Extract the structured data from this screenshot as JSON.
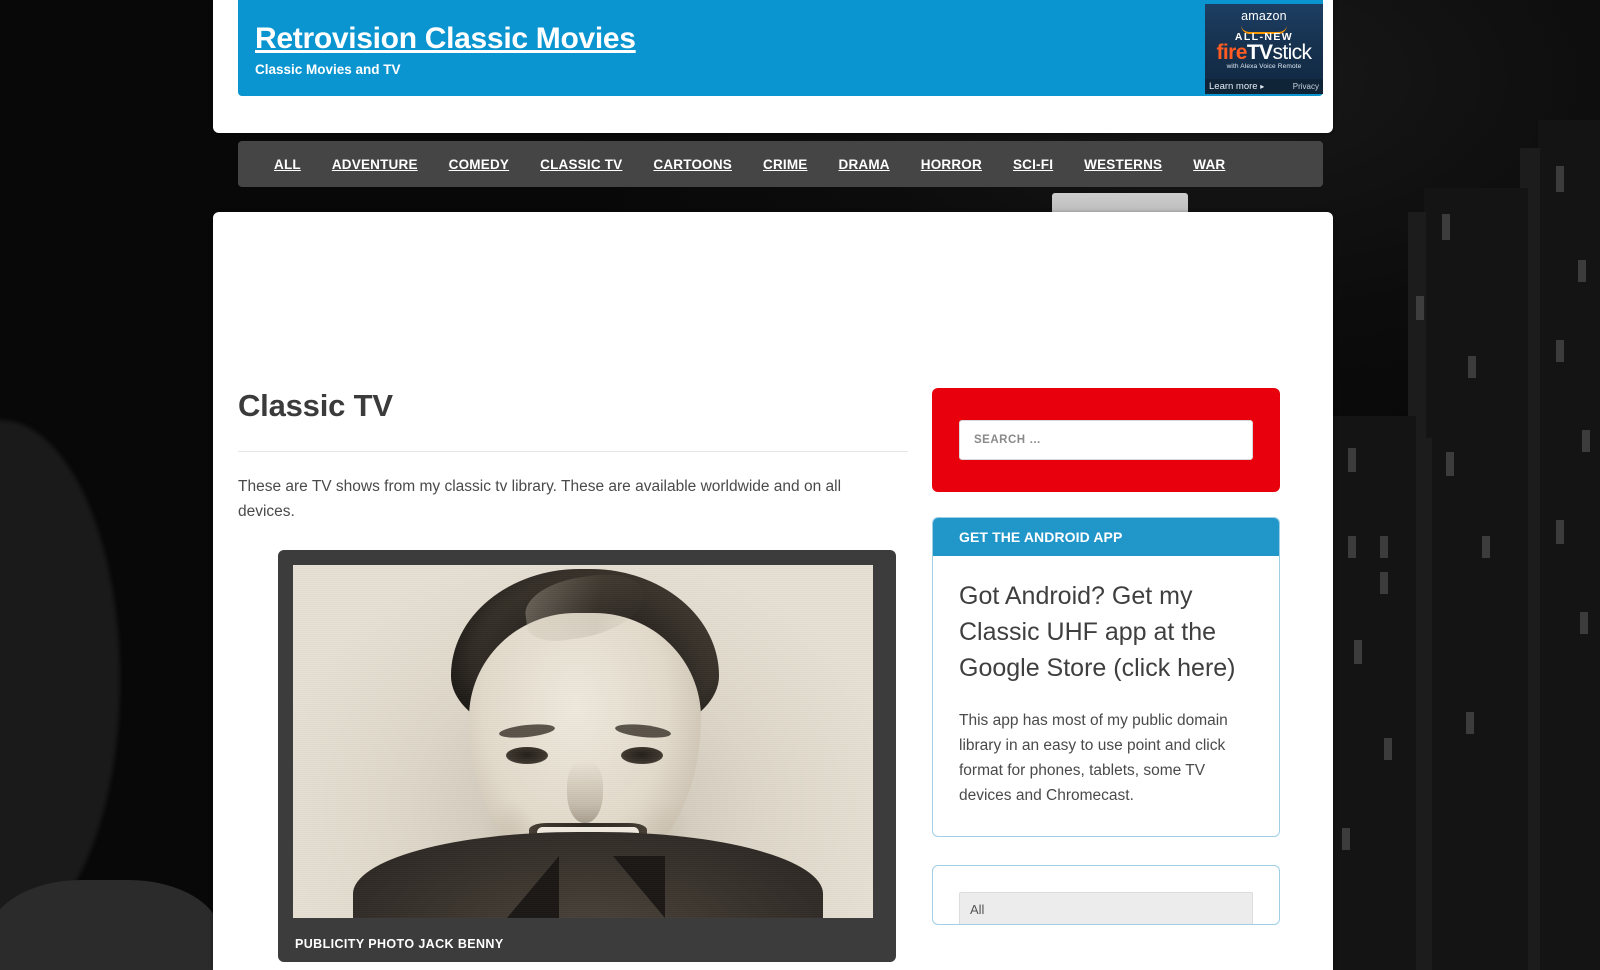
{
  "site": {
    "title": "Retrovision Classic Movies",
    "tagline": "Classic Movies and TV"
  },
  "ad": {
    "brand": "amazon",
    "kicker": "ALL-NEW",
    "product_fire": "fire",
    "product_tv": "TV",
    "product_stick": "stick",
    "subtitle": "with Alexa Voice Remote",
    "learn_more": "Learn more",
    "arrow": "▸",
    "privacy": "Privacy"
  },
  "nav": {
    "items": [
      {
        "label": "ALL"
      },
      {
        "label": "ADVENTURE"
      },
      {
        "label": "COMEDY"
      },
      {
        "label": "CLASSIC TV"
      },
      {
        "label": "CARTOONS"
      },
      {
        "label": "CRIME"
      },
      {
        "label": "DRAMA"
      },
      {
        "label": "HORROR"
      },
      {
        "label": "SCI-FI"
      },
      {
        "label": "WESTERNS"
      },
      {
        "label": "WAR"
      }
    ]
  },
  "article": {
    "title": "Classic TV",
    "intro": "These are TV shows from my classic tv library. These are available worldwide and on all devices.",
    "figure_caption": "PUBLICITY PHOTO JACK BENNY"
  },
  "sidebar": {
    "search": {
      "placeholder": "SEARCH …",
      "value": ""
    },
    "android_widget": {
      "heading": "GET THE ANDROID APP",
      "link_text": "Got Android? Get my Classic UHF app at the Google Store (click here)",
      "description": "This app has most of my public domain library in an easy to use point and click format for phones, tablets, some TV devices and Chromecast."
    },
    "partial_widget": {
      "select_value": "All"
    }
  },
  "colors": {
    "header_blue": "#0b95d0",
    "nav_dark": "#454545",
    "search_red": "#e8000d",
    "widget_blue": "#2196c9",
    "frame_gray": "#3c3c3c"
  }
}
